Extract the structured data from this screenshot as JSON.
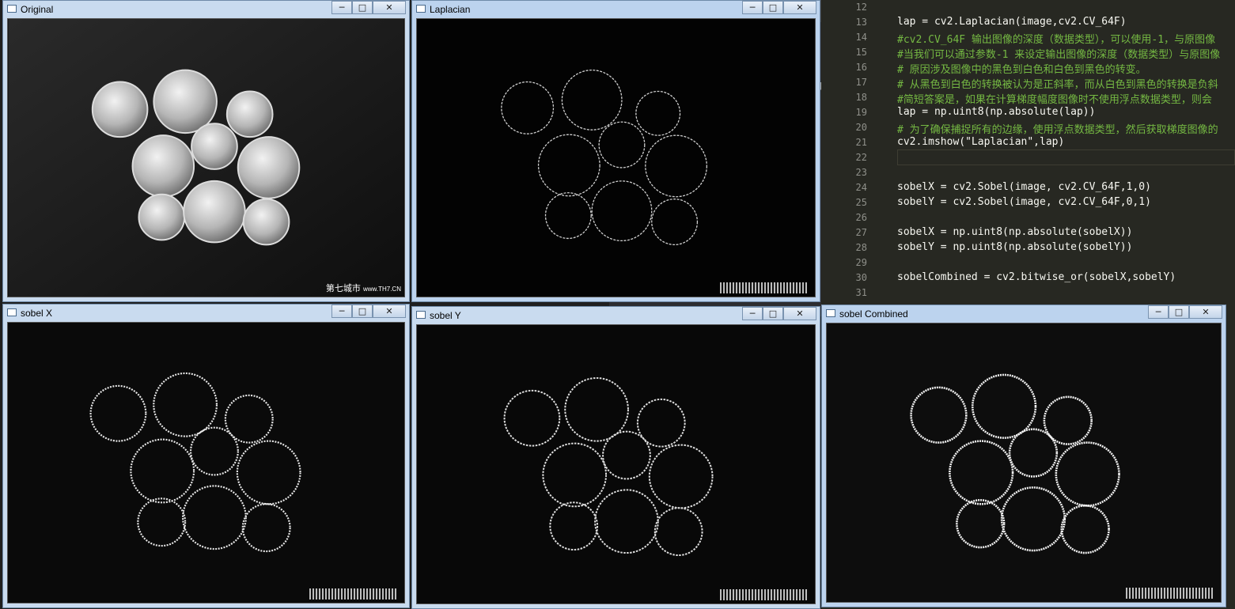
{
  "windows": {
    "original": {
      "title": "Original"
    },
    "laplacian": {
      "title": "Laplacian"
    },
    "sobel_x": {
      "title": "sobel X"
    },
    "sobel_y": {
      "title": "sobel Y"
    },
    "sobel_combined": {
      "title": "sobel Combined"
    }
  },
  "controls": {
    "minimize": "─",
    "maximize": "□",
    "close": "✕"
  },
  "watermark": {
    "name": "第七城市",
    "url": "www.TH7.CN"
  },
  "editor": {
    "sidebar_fragment": "py",
    "lines": [
      {
        "num": "12",
        "text": ""
      },
      {
        "num": "13",
        "text": "lap = cv2.Laplacian(image,cv2.CV_64F)"
      },
      {
        "num": "14",
        "text": "#cv2.CV_64F 输出图像的深度（数据类型），可以使用-1，与原图像"
      },
      {
        "num": "15",
        "text": "#当我们可以通过参数-1 来设定输出图像的深度（数据类型）与原图像"
      },
      {
        "num": "16",
        "text": "# 原因涉及图像中的黑色到白色和白色到黑色的转变。"
      },
      {
        "num": "17",
        "text": "# 从黑色到白色的转换被认为是正斜率，而从白色到黑色的转换是负斜"
      },
      {
        "num": "18",
        "text": "#简短答案是，如果在计算梯度幅度图像时不使用浮点数据类型，则会"
      },
      {
        "num": "19",
        "text": "lap = np.uint8(np.absolute(lap))"
      },
      {
        "num": "20",
        "text": "# 为了确保捕捉所有的边缘，使用浮点数据类型，然后获取梯度图像的"
      },
      {
        "num": "21",
        "text": "cv2.imshow(\"Laplacian\",lap)"
      },
      {
        "num": "22",
        "text": ""
      },
      {
        "num": "23",
        "text": ""
      },
      {
        "num": "24",
        "text": "sobelX = cv2.Sobel(image, cv2.CV_64F,1,0)"
      },
      {
        "num": "25",
        "text": "sobelY = cv2.Sobel(image, cv2.CV_64F,0,1)"
      },
      {
        "num": "26",
        "text": ""
      },
      {
        "num": "27",
        "text": "sobelX = np.uint8(np.absolute(sobelX))"
      },
      {
        "num": "28",
        "text": "sobelY = np.uint8(np.absolute(sobelY))"
      },
      {
        "num": "29",
        "text": ""
      },
      {
        "num": "30",
        "text": "sobelCombined = cv2.bitwise_or(sobelX,sobelY)"
      },
      {
        "num": "31",
        "text": ""
      }
    ]
  }
}
